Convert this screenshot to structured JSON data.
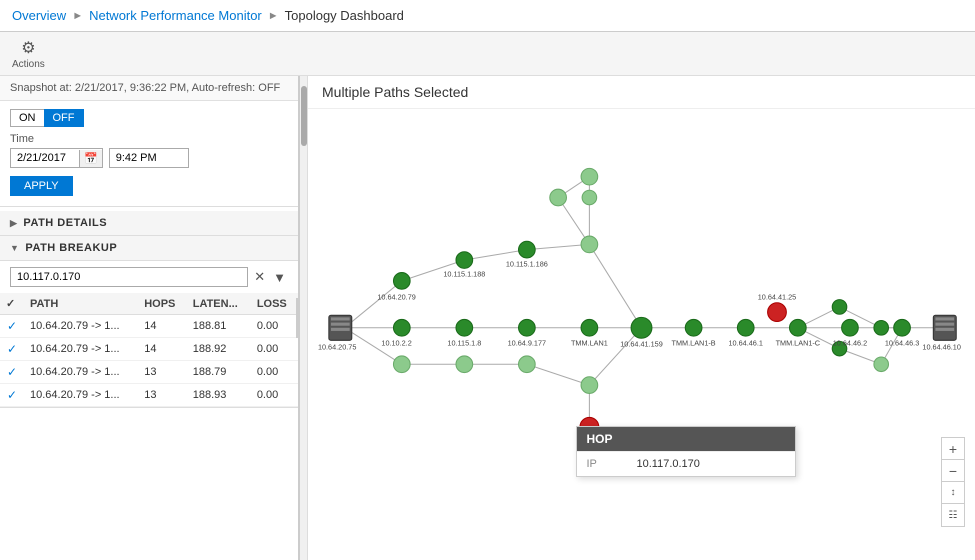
{
  "breadcrumb": {
    "items": [
      "Overview",
      "Network Performance Monitor",
      "Topology Dashboard"
    ]
  },
  "toolbar": {
    "actions_label": "Actions",
    "actions_icon": "⚙"
  },
  "left_panel": {
    "snapshot": "Snapshot at: 2/21/2017, 9:36:22 PM, Auto-refresh: OFF",
    "toggle": {
      "on_label": "ON",
      "off_label": "OFF"
    },
    "time_label": "Time",
    "date_value": "2/21/2017",
    "time_value": "9:42 PM",
    "apply_label": "APPLY",
    "path_details_label": "PATH DETAILS",
    "path_breakup_label": "PATH BREAKUP",
    "search_placeholder": "10.117.0.170",
    "table": {
      "headers": [
        "",
        "PATH",
        "HOPS",
        "LATEN...",
        "LOSS"
      ],
      "rows": [
        {
          "checked": true,
          "path": "10.64.20.79 -> 1...",
          "hops": "14",
          "latency": "188.81",
          "loss": "0.00"
        },
        {
          "checked": true,
          "path": "10.64.20.79 -> 1...",
          "hops": "14",
          "latency": "188.92",
          "loss": "0.00"
        },
        {
          "checked": true,
          "path": "10.64.20.79 -> 1...",
          "hops": "13",
          "latency": "188.79",
          "loss": "0.00"
        },
        {
          "checked": true,
          "path": "10.64.20.79 -> 1...",
          "hops": "13",
          "latency": "188.93",
          "loss": "0.00"
        }
      ]
    }
  },
  "right_panel": {
    "title": "Multiple Paths Selected",
    "hop_popup": {
      "header": "HOP",
      "ip_label": "IP",
      "ip_value": "10.117.0.170"
    }
  },
  "colors": {
    "accent": "#0078d4",
    "node_green_dark": "#1a7a1a",
    "node_green_light": "#7bc67b",
    "node_red": "#cc0000",
    "node_gray": "#888"
  }
}
